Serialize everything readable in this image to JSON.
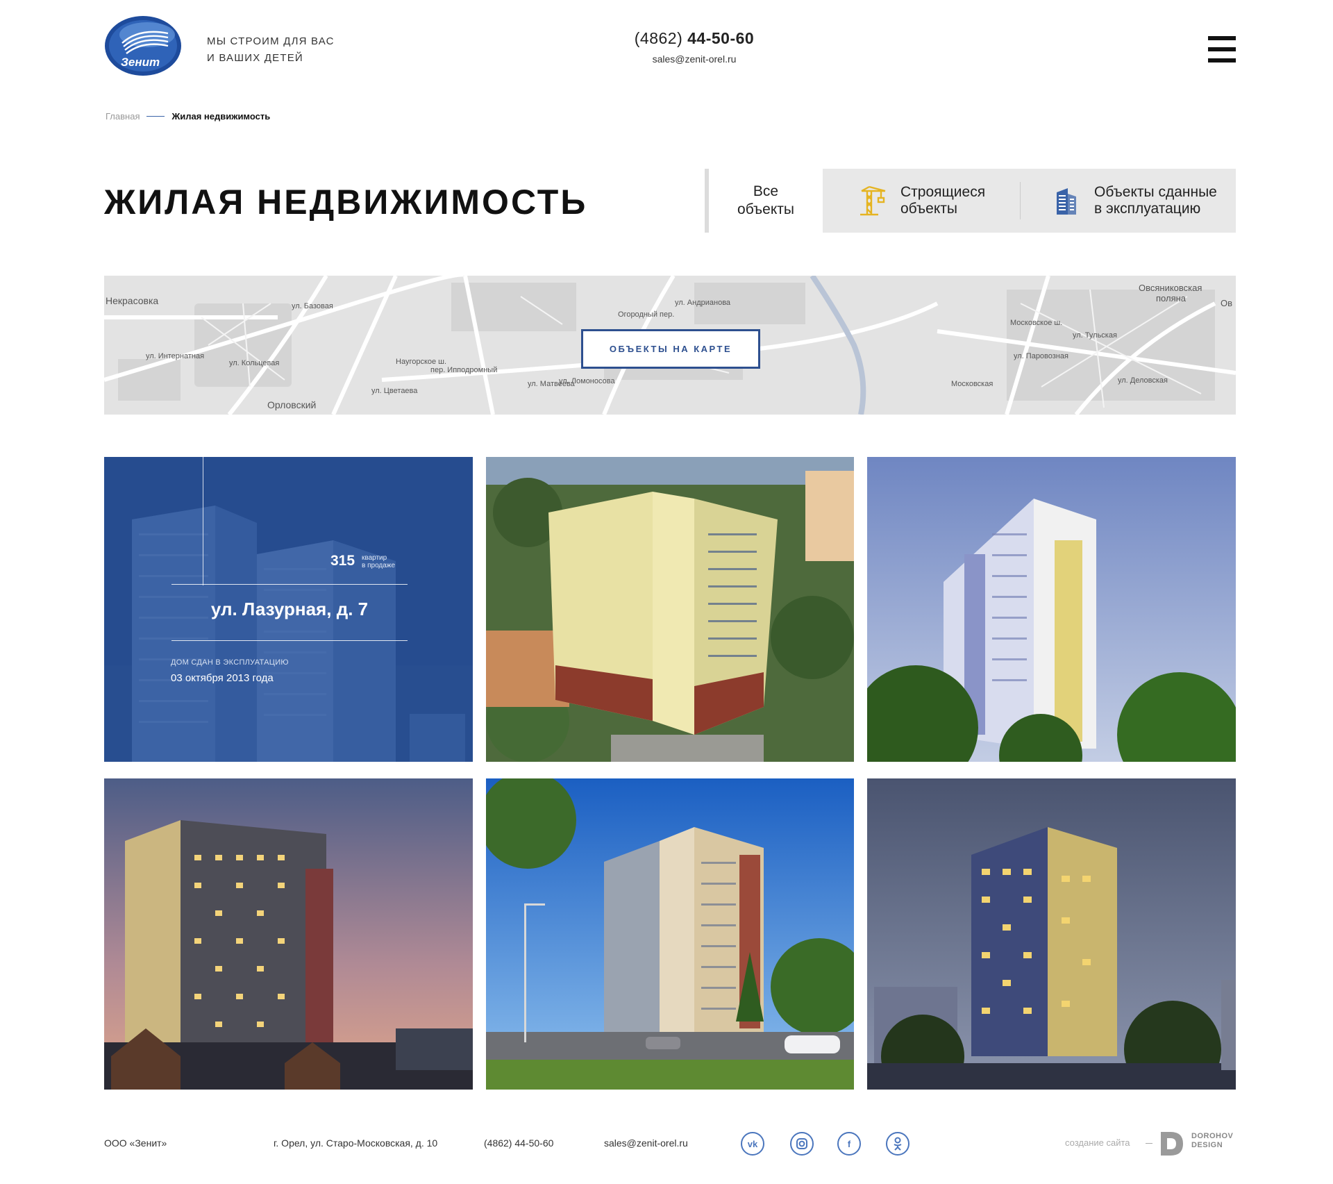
{
  "header": {
    "logo_text": "Зенит",
    "tagline_line1": "Мы строим для вас",
    "tagline_line2": "и ваших детей",
    "phone_code": "(4862)",
    "phone_number": "44-50-60",
    "email": "sales@zenit-orel.ru"
  },
  "breadcrumb": {
    "home": "Главная",
    "current": "Жилая недвижимость"
  },
  "page": {
    "title": "Жилая недвижимость"
  },
  "filter": {
    "all_line1": "Все",
    "all_line2": "объекты",
    "tabs": [
      {
        "line1": "Строящиеся",
        "line2": "объекты",
        "icon": "crane-icon"
      },
      {
        "line1": "Объекты сданные",
        "line2": "в эксплуатацию",
        "icon": "building-icon"
      }
    ]
  },
  "map": {
    "button": "Объекты на карте",
    "labels": [
      "Некрасовка",
      "Овсяниковская",
      "поляна",
      "Орловский",
      "ул. Андрианова",
      "Московское ш.",
      "ул. Ломоносова",
      "пер. Ипподромный",
      "ул. Матвеева",
      "ул. Цветаева",
      "ул. Кольцевая",
      "ул. Базовая",
      "ул. Интернатная",
      "Московская",
      "ул. Тульская",
      "ул. Деловская",
      "ул. Паровозная",
      "Наугорское ш.",
      "Огородный пер.",
      "Ов"
    ]
  },
  "featured": {
    "count": "315",
    "count_label_line1": "квартир",
    "count_label_line2": "в продаже",
    "address": "ул. Лазурная, д. 7",
    "status": "Дом сдан в эксплуатацию",
    "date": "03 октября 2013 года"
  },
  "footer": {
    "company": "ООО «Зенит»",
    "address": "г. Орел, ул. Старо-Московская, д. 10",
    "phone": "(4862) 44-50-60",
    "email": "sales@zenit-orel.ru",
    "social": [
      "vk-icon",
      "instagram-icon",
      "facebook-icon",
      "odnoklassniki-icon"
    ],
    "credit_label": "создание сайта",
    "credit_name_line1": "DOROHOV",
    "credit_name_line2": "DESIGN"
  },
  "colors": {
    "brand_blue": "#2d4f8f",
    "overlay_blue": "#2a56a0",
    "accent_icon": "#3a63a8",
    "crane_yellow": "#e5b422"
  }
}
